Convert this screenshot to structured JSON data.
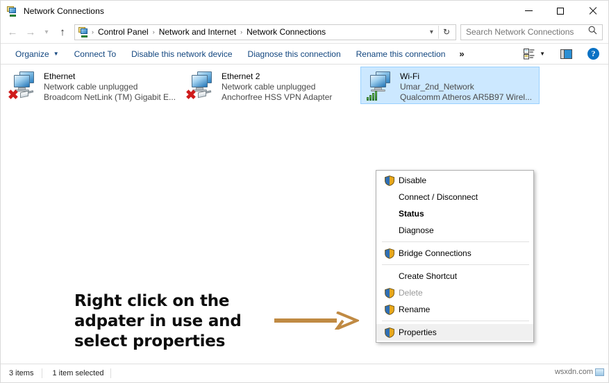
{
  "window": {
    "title": "Network Connections",
    "app_icon": "network-computer-icon",
    "minimize_label": "Minimize",
    "maximize_label": "Maximize",
    "close_label": "Close"
  },
  "nav": {
    "back_icon": "back-arrow-icon",
    "forward_icon": "forward-arrow-icon",
    "recent_icon": "chevron-down-icon",
    "up_icon": "up-arrow-icon",
    "breadcrumbs": [
      "Control Panel",
      "Network and Internet",
      "Network Connections"
    ],
    "separator": "›",
    "dropdown_icon": "chevron-down-icon",
    "refresh_icon": "refresh-icon"
  },
  "search": {
    "placeholder": "Search Network Connections",
    "value": "",
    "icon": "search-icon"
  },
  "toolbar": {
    "organize": "Organize",
    "organize_caret": "▼",
    "connect_to": "Connect To",
    "disable_device": "Disable this network device",
    "diagnose_connection": "Diagnose this connection",
    "rename_connection": "Rename this connection",
    "overflow": "»",
    "view_icon": "view-layout-icon",
    "view_caret": "▼",
    "preview_pane_icon": "preview-pane-icon",
    "help_icon": "help-icon",
    "help_glyph": "?"
  },
  "connections": [
    {
      "name": "Ethernet",
      "status": "Network cable unplugged",
      "device": "Broadcom NetLink (TM) Gigabit E...",
      "selected": false,
      "badge": "disconnected-cable",
      "icon": "network-adapter-icon"
    },
    {
      "name": "Ethernet 2",
      "status": "Network cable unplugged",
      "device": "Anchorfree HSS VPN Adapter",
      "selected": false,
      "badge": "disconnected-cable",
      "icon": "network-adapter-icon"
    },
    {
      "name": "Wi-Fi",
      "status": "Umar_2nd_Network",
      "device": "Qualcomm Atheros AR5B97 Wirel...",
      "selected": true,
      "badge": "signal-bars",
      "icon": "network-adapter-icon"
    }
  ],
  "context_menu": {
    "items": [
      {
        "label": "Disable",
        "shield": true,
        "bold": false,
        "disabled": false,
        "hovered": false,
        "separator_after": false
      },
      {
        "label": "Connect / Disconnect",
        "shield": false,
        "bold": false,
        "disabled": false,
        "hovered": false,
        "separator_after": false
      },
      {
        "label": "Status",
        "shield": false,
        "bold": true,
        "disabled": false,
        "hovered": false,
        "separator_after": false
      },
      {
        "label": "Diagnose",
        "shield": false,
        "bold": false,
        "disabled": false,
        "hovered": false,
        "separator_after": true
      },
      {
        "label": "Bridge Connections",
        "shield": true,
        "bold": false,
        "disabled": false,
        "hovered": false,
        "separator_after": true
      },
      {
        "label": "Create Shortcut",
        "shield": false,
        "bold": false,
        "disabled": false,
        "hovered": false,
        "separator_after": false
      },
      {
        "label": "Delete",
        "shield": true,
        "bold": false,
        "disabled": true,
        "hovered": false,
        "separator_after": false
      },
      {
        "label": "Rename",
        "shield": true,
        "bold": false,
        "disabled": false,
        "hovered": false,
        "separator_after": true
      },
      {
        "label": "Properties",
        "shield": true,
        "bold": false,
        "disabled": false,
        "hovered": true,
        "separator_after": false
      }
    ]
  },
  "annotation": {
    "text": "Right click on the adpater in use and select properties",
    "arrow_color": "#c08a43",
    "arrow_icon": "right-arrow-annotation"
  },
  "statusbar": {
    "item_count": "3 items",
    "selection": "1 item selected",
    "watermark": "wsxdn.com"
  },
  "colors": {
    "selection_fill": "#cce8ff",
    "selection_border": "#99d1ff",
    "command_link": "#12467f",
    "accent_blue": "#0b72c4",
    "annotation_arrow": "#c08a43"
  }
}
